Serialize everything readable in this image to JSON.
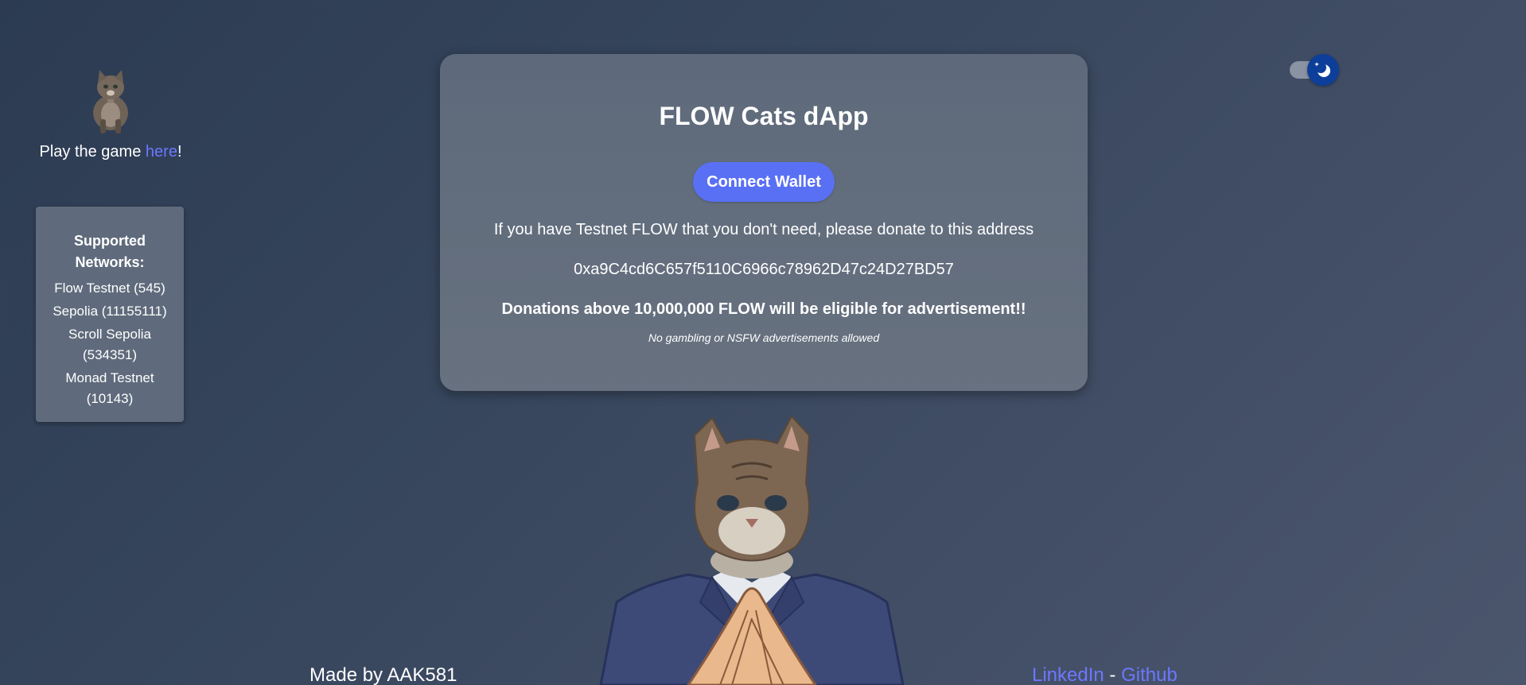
{
  "sidebar": {
    "play_prefix": "Play the game ",
    "play_link": "here",
    "play_suffix": "!",
    "networks_title": "Supported Networks:",
    "networks": [
      "Flow Testnet (545)",
      "Sepolia (11155111)",
      "Scroll Sepolia (534351)",
      "Monad Testnet (10143)"
    ]
  },
  "main": {
    "title": "FLOW Cats dApp",
    "connect_label": "Connect Wallet",
    "donate_text": "If you have Testnet FLOW that you don't need, please donate to this address",
    "address": "0xa9C4cd6C657f5110C6966c78962D47c24D27BD57",
    "donation_notice": "Donations above 10,000,000 FLOW will be eligible for advertisement!!",
    "ad_policy": "No gambling or NSFW advertisements allowed"
  },
  "footer": {
    "made_by": "Made by AAK581",
    "linkedin": "LinkedIn",
    "separator": " - ",
    "github": "Github"
  },
  "theme_toggle": {
    "mode": "dark",
    "icon": "moon-icon"
  },
  "colors": {
    "accent": "#5970f5",
    "link": "#6b78ff",
    "toggle_knob": "#0d3f9a",
    "card": "#5f6b7c"
  }
}
